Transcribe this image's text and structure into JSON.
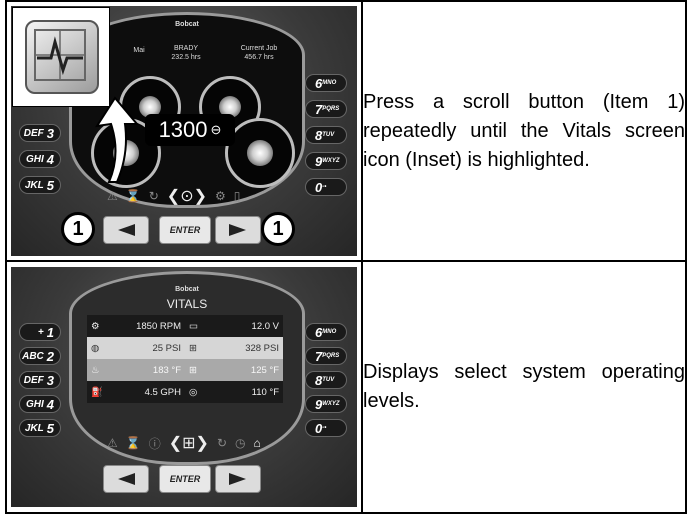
{
  "rows": [
    {
      "description": "Press a scroll button (Item 1) repeatedly until the Vitals screen icon (Inset) is highlighted.",
      "callout": "1",
      "display": {
        "brand": "Bobcat",
        "left_label": "Mai",
        "center_label": "BRADY",
        "center_value": "232.5 hrs",
        "right_label": "Current Job",
        "right_value": "456.7 hrs",
        "readout": "1300",
        "enter_label": "ENTER",
        "left_buttons": [
          {
            "glyph": "DEF",
            "num": "3"
          },
          {
            "glyph": "GHI",
            "num": "4"
          },
          {
            "glyph": "JKL",
            "num": "5"
          }
        ],
        "right_buttons": [
          {
            "num": "6",
            "glyph": "MNO"
          },
          {
            "num": "7",
            "glyph": "PQRS"
          },
          {
            "num": "8",
            "glyph": "TUV"
          },
          {
            "num": "9",
            "glyph": "WXYZ"
          },
          {
            "num": "0",
            "glyph": "-•"
          }
        ]
      }
    },
    {
      "description": "Displays select system operating levels.",
      "display": {
        "brand": "Bobcat",
        "title": "VITALS",
        "enter_label": "ENTER",
        "vitals": [
          {
            "left_value": "1850 RPM",
            "right_value": "12.0 V"
          },
          {
            "left_value": "25 PSI",
            "right_value": "328 PSI"
          },
          {
            "left_value": "183 °F",
            "right_value": "125 °F"
          },
          {
            "left_value": "4.5 GPH",
            "right_value": "110 °F"
          }
        ],
        "left_buttons": [
          {
            "glyph": "+",
            "num": "1"
          },
          {
            "glyph": "ABC",
            "num": "2"
          },
          {
            "glyph": "DEF",
            "num": "3"
          },
          {
            "glyph": "GHI",
            "num": "4"
          },
          {
            "glyph": "JKL",
            "num": "5"
          }
        ],
        "right_buttons": [
          {
            "num": "6",
            "glyph": "MNO"
          },
          {
            "num": "7",
            "glyph": "PQRS"
          },
          {
            "num": "8",
            "glyph": "TUV"
          },
          {
            "num": "9",
            "glyph": "WXYZ"
          },
          {
            "num": "0",
            "glyph": "-•"
          }
        ]
      }
    }
  ]
}
